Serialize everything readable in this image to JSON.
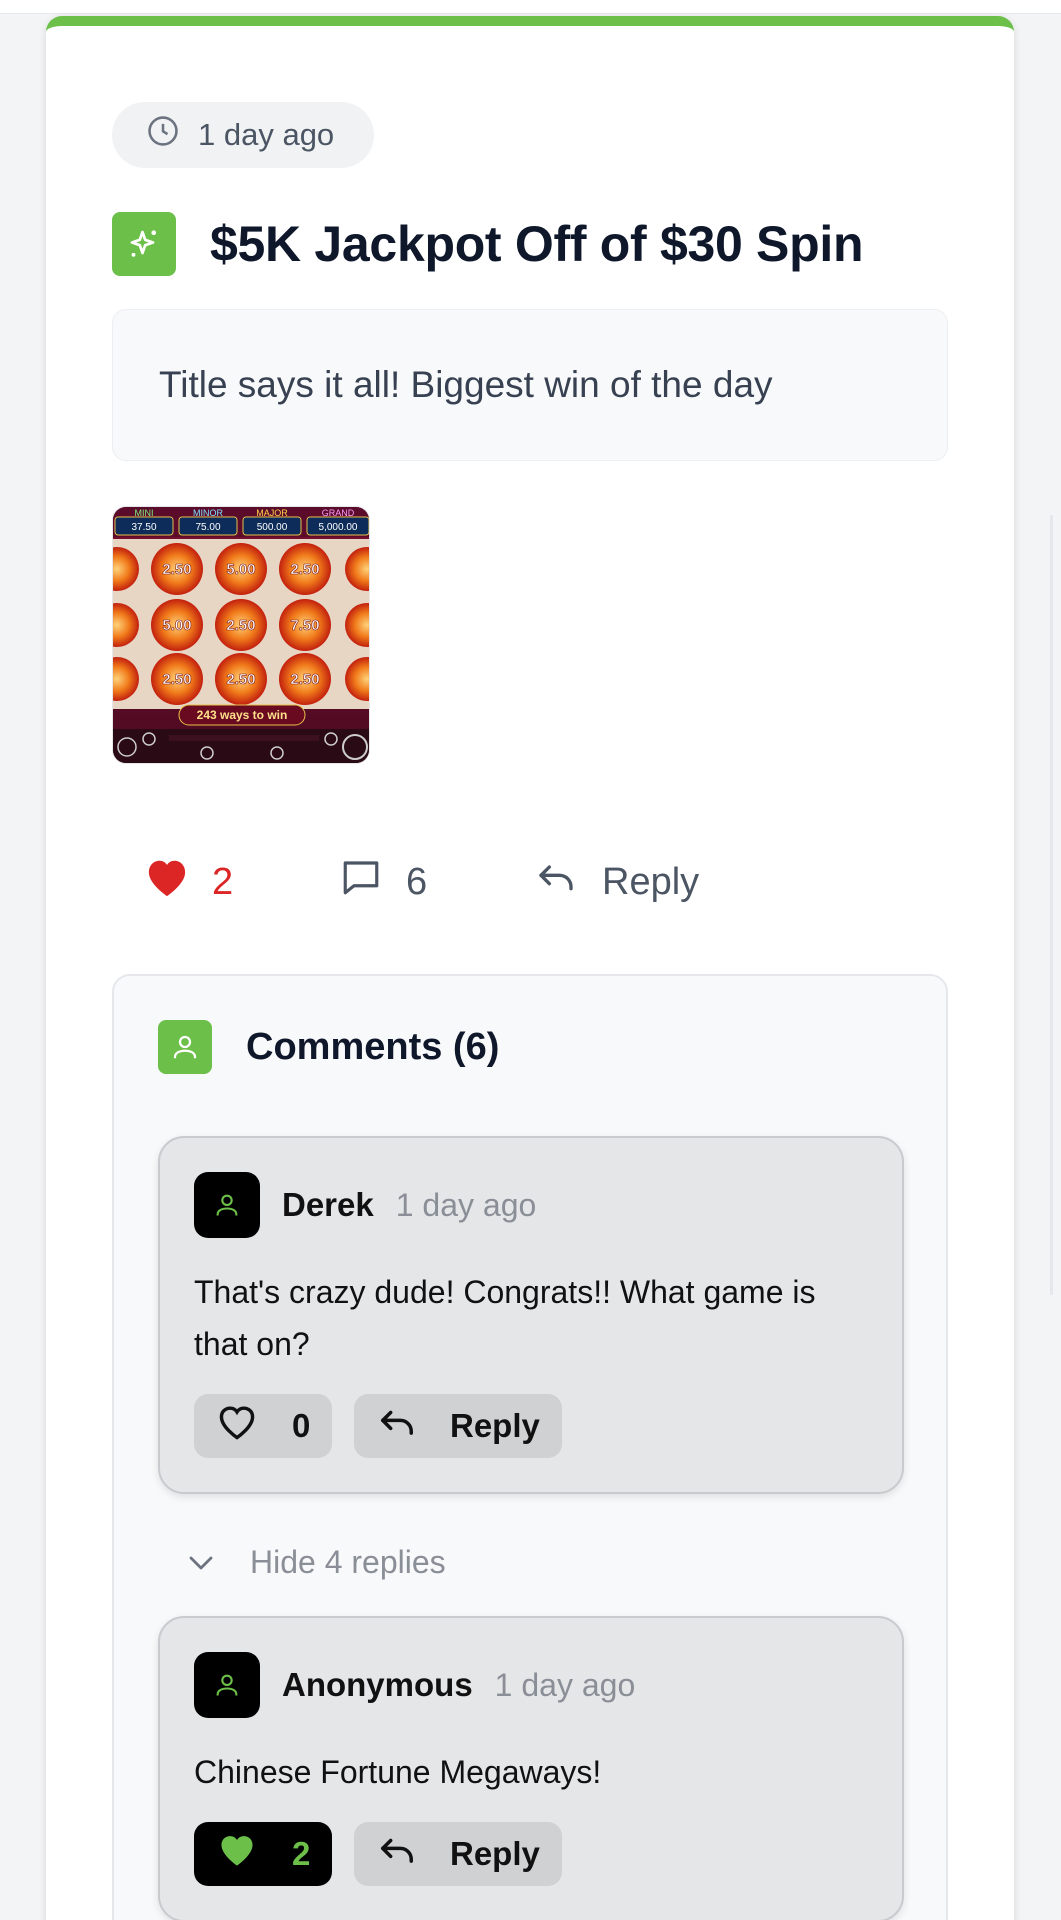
{
  "post": {
    "time": "1 day ago",
    "title": "$5K Jackpot Off of $30 Spin",
    "description": "Title says it all! Biggest win of the day",
    "image": {
      "jackpots": [
        {
          "label": "MINI",
          "value": "37.50"
        },
        {
          "label": "MINOR",
          "value": "75.00"
        },
        {
          "label": "MAJOR",
          "value": "500.00"
        },
        {
          "label": "GRAND",
          "value": "5,000.00"
        }
      ],
      "ways_text": "243 ways to win",
      "coin_values": [
        "2.50",
        "5.00",
        "2.50",
        "5.00",
        "2.50",
        "7.50",
        "2.50",
        "2.50",
        "2.50"
      ]
    },
    "likes": "2",
    "comments_count": "6",
    "reply_label": "Reply"
  },
  "comments_section": {
    "title": "Comments (6)",
    "items": [
      {
        "author": "Derek",
        "time": "1 day ago",
        "text": "That's crazy dude! Congrats!! What game is that on?",
        "likes": "0",
        "liked": false,
        "reply_label": "Reply"
      },
      {
        "author": "Anonymous",
        "time": "1 day ago",
        "text": "Chinese Fortune Megaways!",
        "likes": "2",
        "liked": true,
        "reply_label": "Reply"
      }
    ],
    "toggle_label": "Hide 4 replies"
  },
  "colors": {
    "accent": "#6cc04a",
    "like_red": "#dc2626",
    "text_dark": "#0f172a",
    "muted": "#8a8f97"
  }
}
